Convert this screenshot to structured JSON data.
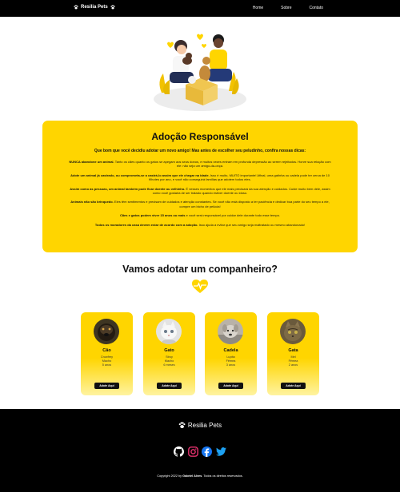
{
  "navbar": {
    "brand": "Resilia Pets",
    "links": [
      "Home",
      "Sobre",
      "Contato"
    ]
  },
  "info": {
    "title": "Adoção Responsável",
    "lead": "Que bom que você decidiu adotar um novo amigo! Mas antes de escolher seu peludinho, confira nossas dicas:",
    "tips": [
      {
        "bold": "NUNCA abandone um animal.",
        "text": " Tanto os cães quanto os gatos se apegam aos seus donos, e muitos vezes entram em profunda depressão ao serem rejeitados. Honre sua relação com ele: não seja um amigo-da-onça."
      },
      {
        "bold": "Adote um animal já castrado, ou comprometa-se a castrá-lo assim que ele chegar na idade.",
        "text": " Isso é muito, MUITO importante! Afinal, uma gatinha ou cadela pode ter cerca de 10 filhotes por ano, e você não conseguirá famílias que adotem todos eles."
      },
      {
        "bold": "Assim como as pessoas, um animal também pode ficar doente ou velhinho.",
        "text": " É nesses momentos que ele mais precisará da sua atenção e cuidados. Cuide muito bem dele, assim como você gostaria de ser tratado quando estiver doente ou idoso."
      },
      {
        "bold": "Animais não são brinquedo.",
        "text": " Eles têm sentimentos e precisam de cuidados e atenção constantes. Se você não está disposto a ter paciência e dedicar boa parte do seu tempo a ele, compre um bicho de pelúcia!"
      },
      {
        "bold": "Cães e gatos podem viver 15 anos ou mais",
        "text": " e você será responsável por cuidar dele durante todo esse tempo."
      },
      {
        "bold": "Todos os moradores da casa devem estar de acordo com a adoção.",
        "text": " Isso ajuda a evitar que seu amigo seja maltratado ou mesmo abandonado!"
      }
    ]
  },
  "section": {
    "title": "Vamos adotar um companheiro?"
  },
  "pets": [
    {
      "name": "Cão",
      "breed": "Crowfrey",
      "sex": "Macho",
      "age": "5 anos",
      "button": "Adote Aqui"
    },
    {
      "name": "Gato",
      "breed": "Stroy",
      "sex": "Macho",
      "age": "6 meses",
      "button": "Adote Aqui"
    },
    {
      "name": "Cadela",
      "breed": "Lupita",
      "sex": "Fêmea",
      "age": "3 anos",
      "button": "Adote Aqui"
    },
    {
      "name": "Gata",
      "breed": "Mel",
      "sex": "Fêmea",
      "age": "2 anos",
      "button": "Adote Aqui"
    }
  ],
  "footer": {
    "brand": "Resilia Pets",
    "socials": [
      "github-icon",
      "instagram-icon",
      "facebook-icon",
      "twitter-icon"
    ],
    "copyright_prefix": "Copyright 2022 by ",
    "copyright_author": "Gabriel Alves",
    "copyright_suffix": ". Todos os direitos reservados."
  },
  "colors": {
    "accent": "#ffd500",
    "dark": "#000000",
    "instagram": "#e1306c",
    "facebook": "#1877f2",
    "twitter": "#1da1f2"
  }
}
